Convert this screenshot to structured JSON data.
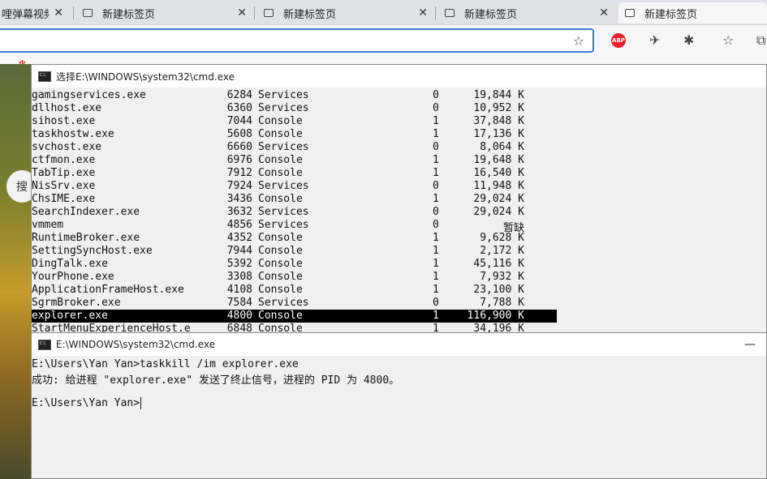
{
  "browser": {
    "tabs": [
      {
        "title": "哩弹幕视频",
        "active": false
      },
      {
        "title": "新建标签页",
        "active": false
      },
      {
        "title": "新建标签页",
        "active": false
      },
      {
        "title": "新建标签页",
        "active": false
      },
      {
        "title": "新建标签页",
        "active": true
      }
    ],
    "close_glyph": "✕",
    "abp_label": "ABP"
  },
  "desktop": {
    "search_hint": "搜"
  },
  "cmd1": {
    "title": "选择E:\\WINDOWS\\system32\\cmd.exe",
    "rows": [
      {
        "name": "gamingservices.exe",
        "pid": "6284",
        "session": "Services",
        "num": "0",
        "mem": "19,844 K"
      },
      {
        "name": "dllhost.exe",
        "pid": "6360",
        "session": "Services",
        "num": "0",
        "mem": "10,952 K"
      },
      {
        "name": "sihost.exe",
        "pid": "7044",
        "session": "Console",
        "num": "1",
        "mem": "37,848 K"
      },
      {
        "name": "taskhostw.exe",
        "pid": "5608",
        "session": "Console",
        "num": "1",
        "mem": "17,136 K"
      },
      {
        "name": "svchost.exe",
        "pid": "6660",
        "session": "Services",
        "num": "0",
        "mem": "8,064 K"
      },
      {
        "name": "ctfmon.exe",
        "pid": "6976",
        "session": "Console",
        "num": "1",
        "mem": "19,648 K"
      },
      {
        "name": "TabTip.exe",
        "pid": "7912",
        "session": "Console",
        "num": "1",
        "mem": "16,540 K"
      },
      {
        "name": "NisSrv.exe",
        "pid": "7924",
        "session": "Services",
        "num": "0",
        "mem": "11,948 K"
      },
      {
        "name": "ChsIME.exe",
        "pid": "3436",
        "session": "Console",
        "num": "1",
        "mem": "29,024 K"
      },
      {
        "name": "SearchIndexer.exe",
        "pid": "3632",
        "session": "Services",
        "num": "0",
        "mem": "29,024 K"
      },
      {
        "name": "vmmem",
        "pid": "4856",
        "session": "Services",
        "num": "0",
        "mem": "暂缺"
      },
      {
        "name": "RuntimeBroker.exe",
        "pid": "4352",
        "session": "Console",
        "num": "1",
        "mem": "9,628 K"
      },
      {
        "name": "SettingSyncHost.exe",
        "pid": "7944",
        "session": "Console",
        "num": "1",
        "mem": "2,172 K"
      },
      {
        "name": "DingTalk.exe",
        "pid": "5392",
        "session": "Console",
        "num": "1",
        "mem": "45,116 K"
      },
      {
        "name": "YourPhone.exe",
        "pid": "3308",
        "session": "Console",
        "num": "1",
        "mem": "7,932 K"
      },
      {
        "name": "ApplicationFrameHost.exe",
        "pid": "4108",
        "session": "Console",
        "num": "1",
        "mem": "23,100 K"
      },
      {
        "name": "SgrmBroker.exe",
        "pid": "7584",
        "session": "Services",
        "num": "0",
        "mem": "7,788 K"
      },
      {
        "name": "explorer.exe",
        "pid": "4800",
        "session": "Console",
        "num": "1",
        "mem": "116,900 K",
        "selected": true
      },
      {
        "name": "StartMenuExperienceHost.e",
        "pid": "6848",
        "session": "Console",
        "num": "1",
        "mem": "34,196 K"
      }
    ]
  },
  "cmd2": {
    "title": "E:\\WINDOWS\\system32\\cmd.exe",
    "minimize_glyph": "—",
    "lines": [
      "E:\\Users\\Yan Yan>taskkill /im explorer.exe",
      "成功: 给进程 \"explorer.exe\" 发送了终止信号，进程的 PID 为 4800。",
      "",
      "E:\\Users\\Yan Yan>"
    ]
  }
}
